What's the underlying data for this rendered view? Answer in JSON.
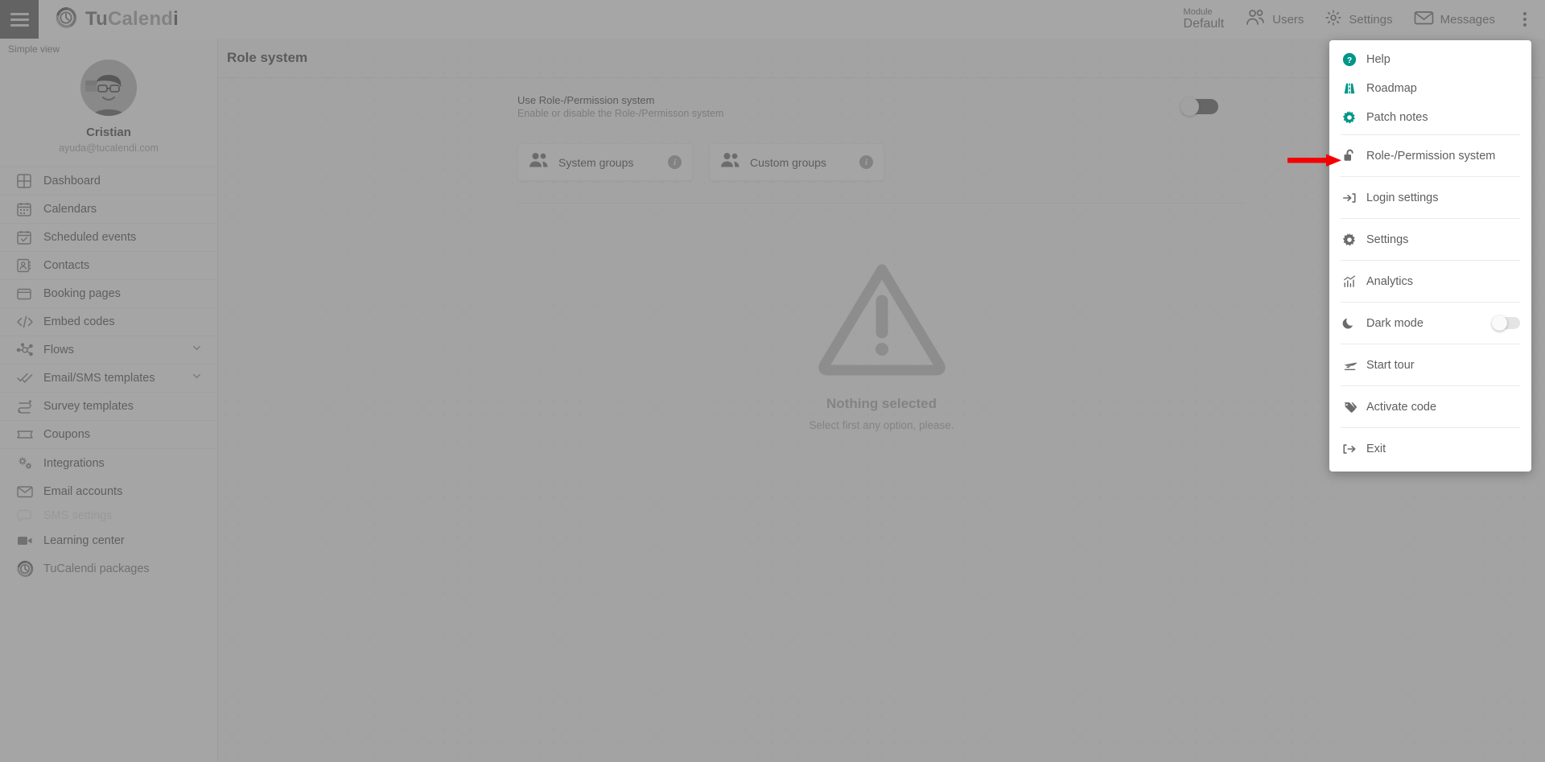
{
  "header": {
    "hamburger_icon": "hamburger-menu-icon",
    "logo": {
      "icon": "tucalendi-clock-logo-icon",
      "part1": "Tu",
      "part2": "Calend",
      "part3": "i"
    },
    "module": {
      "label": "Module",
      "value": "Default"
    },
    "items": [
      {
        "icon": "users-icon",
        "label": "Users"
      },
      {
        "icon": "gear-icon",
        "label": "Settings"
      },
      {
        "icon": "envelope-icon",
        "label": "Messages"
      }
    ],
    "overflow_icon": "vertical-dots-icon"
  },
  "sidebar": {
    "simple_view": "Simple view",
    "profile": {
      "avatar": "user-avatar",
      "name": "Cristian",
      "email": "ayuda@tucalendi.com"
    },
    "items": [
      {
        "icon": "dashboard-grid-icon",
        "label": "Dashboard",
        "expandable": false,
        "accent": false
      },
      {
        "icon": "calendar-icon",
        "label": "Calendars",
        "expandable": false,
        "accent": false
      },
      {
        "icon": "calendar-check-icon",
        "label": "Scheduled events",
        "expandable": false,
        "accent": false
      },
      {
        "icon": "contact-card-icon",
        "label": "Contacts",
        "expandable": false,
        "accent": false
      },
      {
        "icon": "booking-page-icon",
        "label": "Booking pages",
        "expandable": false,
        "accent": false
      },
      {
        "icon": "code-brackets-icon",
        "label": "Embed codes",
        "expandable": false,
        "accent": false
      },
      {
        "icon": "flows-nodes-icon",
        "label": "Flows",
        "expandable": true,
        "accent": false
      },
      {
        "icon": "double-check-icon",
        "label": "Email/SMS templates",
        "expandable": true,
        "accent": false
      },
      {
        "icon": "survey-arrows-icon",
        "label": "Survey templates",
        "expandable": false,
        "accent": false
      },
      {
        "icon": "coupon-ticket-icon",
        "label": "Coupons",
        "expandable": false,
        "accent": false
      },
      {
        "icon": "gears-icon",
        "label": "Integrations",
        "expandable": false,
        "accent": false
      },
      {
        "icon": "envelope-icon",
        "label": "Email accounts",
        "expandable": false,
        "accent": false
      },
      {
        "icon": "sms-icon",
        "label": "SMS settings",
        "expandable": false,
        "accent": false
      },
      {
        "icon": "video-camera-icon",
        "label": "Learning center",
        "expandable": false,
        "accent": false
      },
      {
        "icon": "tucalendi-clock-logo-icon",
        "label": "TuCalendi packages",
        "expandable": false,
        "accent": true
      }
    ],
    "chevron_icon": "chevron-down-icon"
  },
  "main": {
    "page_title": "Role system",
    "toggle_row": {
      "title": "Use Role-/Permission system",
      "subtitle": "Enable or disable the Role-/Permisson system",
      "toggle_name": "role-permission-system-toggle",
      "toggle_state": "off"
    },
    "cards": [
      {
        "icon": "users-group-icon",
        "label": "System groups",
        "info_icon": "info-icon",
        "info_glyph": "i"
      },
      {
        "icon": "users-group-icon",
        "label": "Custom groups",
        "info_icon": "info-icon",
        "info_glyph": "i"
      }
    ],
    "empty_state": {
      "icon": "warning-triangle-icon",
      "title": "Nothing selected",
      "subtitle": "Select first any option, please."
    }
  },
  "menu": {
    "items": [
      {
        "icon": "help-circle-icon",
        "label": "Help",
        "accent": true,
        "divider_after": false,
        "toggle": false
      },
      {
        "icon": "roadmap-icon",
        "label": "Roadmap",
        "accent": true,
        "divider_after": false,
        "toggle": false
      },
      {
        "icon": "gear-icon",
        "label": "Patch notes",
        "accent": true,
        "divider_after": true,
        "toggle": false
      },
      {
        "icon": "unlock-icon",
        "label": "Role-/Permission system",
        "accent": false,
        "divider_after": true,
        "toggle": false
      },
      {
        "icon": "login-arrow-icon",
        "label": "Login settings",
        "accent": false,
        "divider_after": true,
        "toggle": false
      },
      {
        "icon": "gear-icon",
        "label": "Settings",
        "accent": false,
        "divider_after": true,
        "toggle": false
      },
      {
        "icon": "analytics-chart-icon",
        "label": "Analytics",
        "accent": false,
        "divider_after": true,
        "toggle": false
      },
      {
        "icon": "moon-icon",
        "label": "Dark mode",
        "accent": false,
        "divider_after": true,
        "toggle": true
      },
      {
        "icon": "airplane-icon",
        "label": "Start tour",
        "accent": false,
        "divider_after": true,
        "toggle": false
      },
      {
        "icon": "tag-icon",
        "label": "Activate code",
        "accent": false,
        "divider_after": true,
        "toggle": false
      },
      {
        "icon": "logout-icon",
        "label": "Exit",
        "accent": false,
        "divider_after": false,
        "toggle": false
      }
    ],
    "dark_mode_toggle_state": "off"
  },
  "annotation": {
    "icon": "red-arrow-annotation",
    "points_at": "Role-/Permission system"
  },
  "colors": {
    "brand_teal": "#00897b",
    "header_teal_dark": "#00584d",
    "accent_amber": "#d99a00",
    "accent_red": "#b3261e",
    "annotation_red": "#f40000"
  }
}
